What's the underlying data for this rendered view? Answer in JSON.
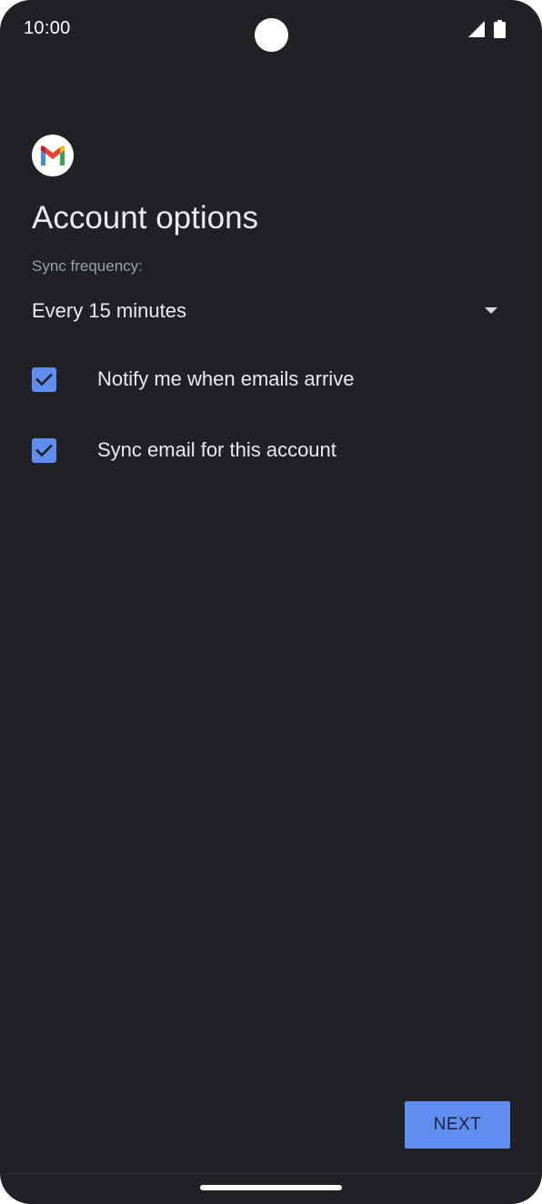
{
  "status_bar": {
    "time": "10:00",
    "icons": [
      "signal-icon",
      "battery-icon"
    ]
  },
  "app": {
    "logo": "gmail-logo",
    "colors": {
      "background": "#202124",
      "accent": "#5f8ef0",
      "text": "#e8eaed",
      "secondary_text": "#9aa0a6"
    }
  },
  "page": {
    "title": "Account options",
    "sync_frequency": {
      "label": "Sync frequency:",
      "selected": "Every 15 minutes"
    },
    "options": [
      {
        "label": "Notify me when emails arrive",
        "checked": true
      },
      {
        "label": "Sync email for this account",
        "checked": true
      }
    ],
    "next_label": "NEXT"
  }
}
